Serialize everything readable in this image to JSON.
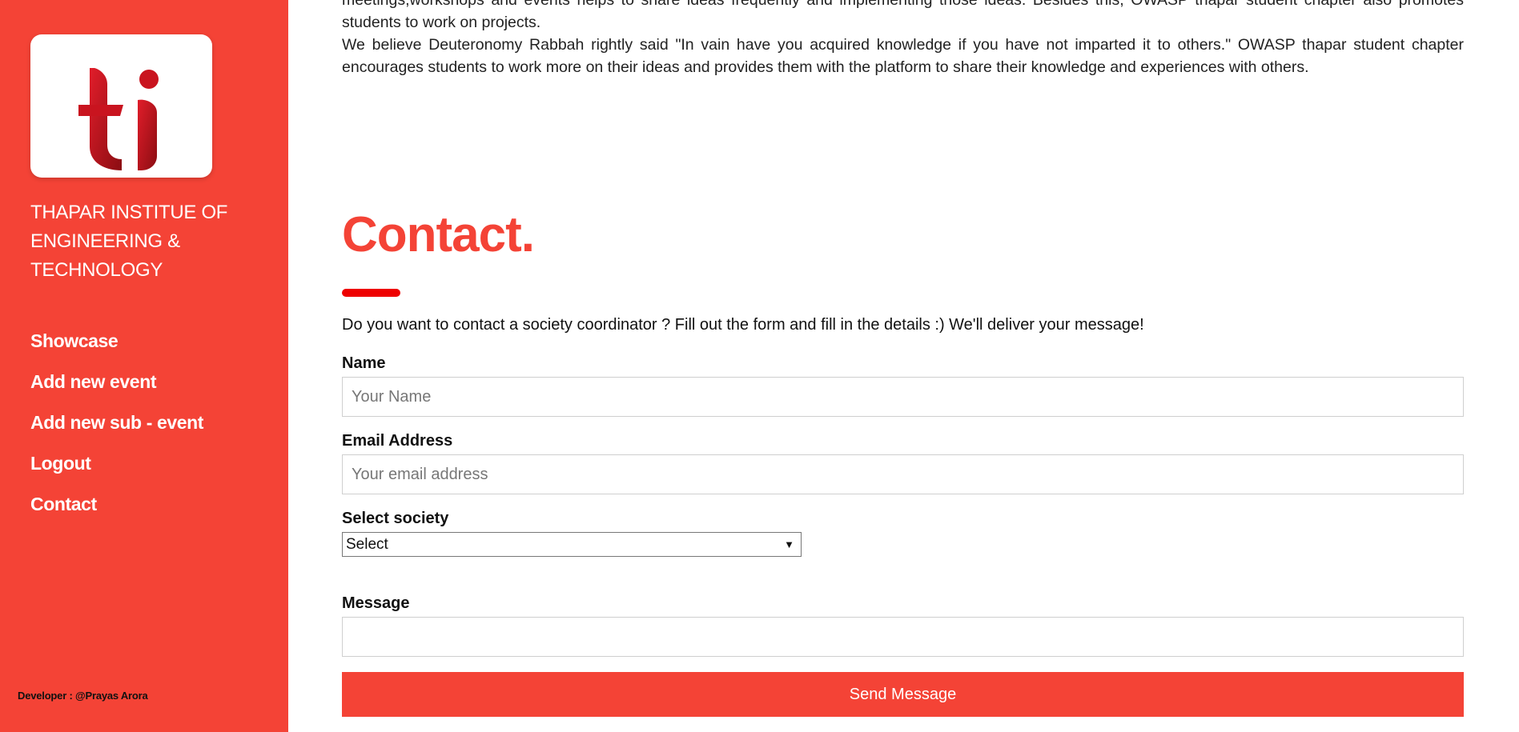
{
  "sidebar": {
    "institute_name": "THAPAR INSTITUE OF ENGINEERING & TECHNOLOGY",
    "nav_items": [
      {
        "label": "Showcase"
      },
      {
        "label": "Add new event"
      },
      {
        "label": "Add new sub - event"
      },
      {
        "label": "Logout"
      },
      {
        "label": "Contact"
      }
    ],
    "developer_credit": "Developer : @Prayas Arora",
    "logo_text": "ti",
    "background_color": "#f44336"
  },
  "intro": {
    "paragraph_1": "meetings,workshops and events helps to share ideas frequently and implementing those ideas. Besides this, OWASP thapar student chapter also promotes students to work on projects.",
    "paragraph_2": "We believe Deuteronomy Rabbah rightly said \"In vain have you acquired knowledge if you have not imparted it to others.\" OWASP thapar student chapter encourages students to work more on their ideas and provides them with the platform to share their knowledge and experiences with others."
  },
  "contact": {
    "title": "Contact.",
    "description": "Do you want to contact a society coordinator ? Fill out the form and fill in the details :) We'll deliver your message!",
    "name_label": "Name",
    "name_placeholder": "Your Name",
    "email_label": "Email Address",
    "email_placeholder": "Your email address",
    "society_label": "Select society",
    "society_selected": "Select",
    "message_label": "Message",
    "message_value": "",
    "send_label": "Send Message",
    "accent_color": "#f44336"
  }
}
